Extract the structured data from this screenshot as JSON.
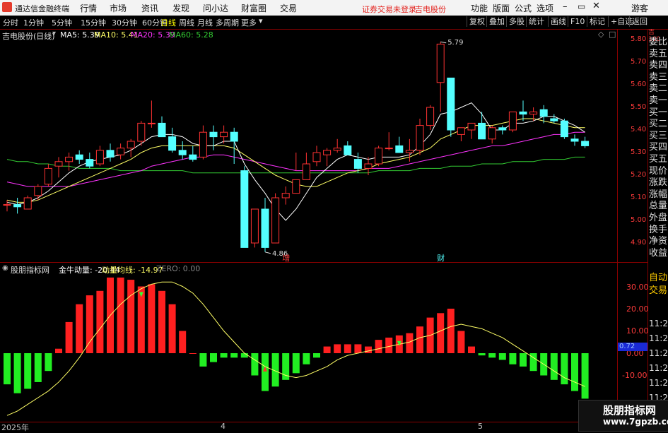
{
  "menubar": {
    "app_title": "通达信金融终端",
    "menus": [
      "行情",
      "市场",
      "资讯",
      "发现",
      "问小达",
      "财富圈",
      "交易"
    ],
    "status_text": "证券交易未登录",
    "stock_name": "吉电股份",
    "right_menus": [
      "功能",
      "版面",
      "公式",
      "选项"
    ],
    "guest": "游客"
  },
  "toolbar": {
    "timeframes": [
      "分时",
      "1分钟",
      "5分钟",
      "15分钟",
      "30分钟",
      "60分钟",
      "日线",
      "周线",
      "月线",
      "多周期",
      "更多"
    ],
    "selected": "日线",
    "buttons": [
      "复权",
      "叠加",
      "多股",
      "统计",
      "画线",
      "F10",
      "标记",
      "+自选",
      "返回"
    ]
  },
  "price_panel": {
    "title": "吉电股份(日线)",
    "ma5_label": "MA5: 5.39",
    "ma10_label": "MA10: 5.41",
    "ma20_label": "MA20: 5.39",
    "ma60_label": "MA60: 5.28",
    "high_label": "5.79",
    "low_label": "4.86",
    "marker_zeng": "增",
    "marker_cai": "财",
    "y_ticks": [
      "5.80",
      "5.70",
      "5.60",
      "5.50",
      "5.40",
      "5.30",
      "5.20",
      "5.10",
      "5.00",
      "4.90"
    ],
    "colors": {
      "up": "#ff3232",
      "down": "#54ffff",
      "ma5": "#ffffff",
      "ma10": "#ffff66",
      "ma20": "#ff33ff",
      "ma60": "#33cc33"
    }
  },
  "indicator_panel": {
    "source": "股朋指标网",
    "name_label": "金牛动量: -20.44",
    "avg_label": "动量均线: -14.97",
    "zero_label": "ZERO: 0.00",
    "y_ticks": [
      "30.00",
      "20.00",
      "10.00",
      "0.00",
      "-10.00"
    ],
    "current_tag": "0.72"
  },
  "time_axis": {
    "labels": [
      "2025年",
      "4",
      "5"
    ]
  },
  "right_panel": {
    "items": [
      "委比",
      "卖五",
      "卖四",
      "卖三",
      "卖二",
      "卖一",
      "买一",
      "买二",
      "买三",
      "买四",
      "买五",
      "现价",
      "涨跌",
      "涨幅",
      "总量",
      "外盘",
      "换手",
      "净资",
      "收益",
      "自动",
      "交易"
    ],
    "times": [
      "11:29",
      "11:29",
      "11:29",
      "11:29",
      "11:29",
      "11:29",
      "11:29"
    ]
  },
  "watermark": {
    "line1": "股朋指标网",
    "line2": "www.7gpzb.com"
  },
  "chart_data": [
    {
      "type": "candlestick",
      "title": "吉电股份(日线)",
      "ylim": [
        4.85,
        5.82
      ],
      "ohlc": [
        [
          5.07,
          5.09,
          5.04,
          5.07
        ],
        [
          5.07,
          5.1,
          5.03,
          5.06
        ],
        [
          5.05,
          5.11,
          5.05,
          5.1
        ],
        [
          5.11,
          5.16,
          5.09,
          5.15
        ],
        [
          5.16,
          5.25,
          5.15,
          5.23
        ],
        [
          5.24,
          5.28,
          5.19,
          5.26
        ],
        [
          5.26,
          5.3,
          5.22,
          5.28
        ],
        [
          5.29,
          5.31,
          5.25,
          5.27
        ],
        [
          5.27,
          5.3,
          5.23,
          5.24
        ],
        [
          5.25,
          5.33,
          5.24,
          5.31
        ],
        [
          5.31,
          5.34,
          5.26,
          5.28
        ],
        [
          5.29,
          5.34,
          5.27,
          5.32
        ],
        [
          5.32,
          5.36,
          5.28,
          5.35
        ],
        [
          5.35,
          5.44,
          5.33,
          5.43
        ],
        [
          5.43,
          5.53,
          5.41,
          5.43
        ],
        [
          5.43,
          5.46,
          5.37,
          5.37
        ],
        [
          5.37,
          5.41,
          5.3,
          5.31
        ],
        [
          5.31,
          5.35,
          5.27,
          5.29
        ],
        [
          5.29,
          5.33,
          5.26,
          5.27
        ],
        [
          5.28,
          5.42,
          5.27,
          5.39
        ],
        [
          5.39,
          5.42,
          5.31,
          5.37
        ],
        [
          5.37,
          5.42,
          5.34,
          5.39
        ],
        [
          5.39,
          5.41,
          5.25,
          5.35
        ],
        [
          5.22,
          5.24,
          4.88,
          4.88
        ],
        [
          4.9,
          5.05,
          4.88,
          5.05
        ],
        [
          5.05,
          5.1,
          4.86,
          4.88
        ],
        [
          4.9,
          5.12,
          4.9,
          5.1
        ],
        [
          5.1,
          5.15,
          5.07,
          5.12
        ],
        [
          5.12,
          5.3,
          5.22,
          5.18
        ],
        [
          5.18,
          5.3,
          5.21,
          5.25
        ],
        [
          5.26,
          5.33,
          5.24,
          5.3
        ],
        [
          5.29,
          5.32,
          5.24,
          5.31
        ],
        [
          5.31,
          5.36,
          5.3,
          5.32
        ],
        [
          5.33,
          5.35,
          5.29,
          5.29
        ],
        [
          5.27,
          5.3,
          5.21,
          5.23
        ],
        [
          5.23,
          5.28,
          5.2,
          5.25
        ],
        [
          5.25,
          5.33,
          5.24,
          5.32
        ],
        [
          5.32,
          5.39,
          5.31,
          5.32
        ],
        [
          5.33,
          5.37,
          5.3,
          5.3
        ],
        [
          5.3,
          5.36,
          5.26,
          5.31
        ],
        [
          5.31,
          5.45,
          5.29,
          5.42
        ],
        [
          5.42,
          5.51,
          5.4,
          5.5
        ],
        [
          5.61,
          5.79,
          5.48,
          5.78
        ],
        [
          5.63,
          5.63,
          5.37,
          5.4
        ],
        [
          5.38,
          5.41,
          5.35,
          5.41
        ],
        [
          5.4,
          5.43,
          5.36,
          5.43
        ],
        [
          5.43,
          5.48,
          5.39,
          5.36
        ],
        [
          5.36,
          5.42,
          5.34,
          5.41
        ],
        [
          5.41,
          5.42,
          5.38,
          5.4
        ],
        [
          5.4,
          5.48,
          5.39,
          5.48
        ],
        [
          5.48,
          5.53,
          5.44,
          5.47
        ],
        [
          5.47,
          5.5,
          5.44,
          5.48
        ],
        [
          5.49,
          5.51,
          5.43,
          5.46
        ],
        [
          5.45,
          5.47,
          5.43,
          5.44
        ],
        [
          5.44,
          5.45,
          5.36,
          5.37
        ],
        [
          5.36,
          5.38,
          5.33,
          5.35
        ],
        [
          5.35,
          5.37,
          5.32,
          5.33
        ]
      ],
      "ma5": [
        5.08,
        5.07,
        5.08,
        5.1,
        5.13,
        5.17,
        5.21,
        5.24,
        5.26,
        5.27,
        5.28,
        5.29,
        5.31,
        5.34,
        5.37,
        5.38,
        5.38,
        5.37,
        5.34,
        5.33,
        5.33,
        5.35,
        5.35,
        5.25,
        5.18,
        5.12,
        5.05,
        5.0,
        5.05,
        5.12,
        5.19,
        5.23,
        5.27,
        5.29,
        5.28,
        5.27,
        5.28,
        5.28,
        5.28,
        5.29,
        5.33,
        5.38,
        5.47,
        5.48,
        5.5,
        5.52,
        5.47,
        5.4,
        5.4,
        5.43,
        5.43,
        5.44,
        5.46,
        5.46,
        5.44,
        5.42,
        5.39
      ],
      "ma10": [
        5.09,
        5.08,
        5.08,
        5.09,
        5.11,
        5.13,
        5.15,
        5.17,
        5.19,
        5.21,
        5.23,
        5.25,
        5.27,
        5.3,
        5.32,
        5.33,
        5.33,
        5.33,
        5.33,
        5.33,
        5.33,
        5.33,
        5.32,
        5.29,
        5.26,
        5.23,
        5.2,
        5.18,
        5.16,
        5.15,
        5.15,
        5.17,
        5.19,
        5.21,
        5.22,
        5.23,
        5.25,
        5.26,
        5.27,
        5.28,
        5.3,
        5.32,
        5.36,
        5.38,
        5.4,
        5.42,
        5.42,
        5.42,
        5.43,
        5.44,
        5.45,
        5.45,
        5.44,
        5.43,
        5.42,
        5.41,
        5.41
      ],
      "ma20": [
        5.17,
        5.16,
        5.15,
        5.15,
        5.15,
        5.15,
        5.15,
        5.16,
        5.17,
        5.18,
        5.19,
        5.2,
        5.21,
        5.22,
        5.24,
        5.25,
        5.26,
        5.27,
        5.28,
        5.28,
        5.29,
        5.29,
        5.28,
        5.27,
        5.26,
        5.25,
        5.24,
        5.23,
        5.22,
        5.22,
        5.22,
        5.22,
        5.22,
        5.22,
        5.22,
        5.23,
        5.23,
        5.23,
        5.24,
        5.25,
        5.26,
        5.27,
        5.28,
        5.29,
        5.3,
        5.31,
        5.32,
        5.33,
        5.33,
        5.34,
        5.35,
        5.36,
        5.37,
        5.38,
        5.38,
        5.39,
        5.39
      ],
      "ma60": [
        5.27,
        5.26,
        5.26,
        5.25,
        5.25,
        5.24,
        5.24,
        5.23,
        5.23,
        5.23,
        5.23,
        5.22,
        5.22,
        5.22,
        5.22,
        5.22,
        5.22,
        5.22,
        5.21,
        5.21,
        5.21,
        5.21,
        5.21,
        5.21,
        5.21,
        5.21,
        5.21,
        5.21,
        5.21,
        5.21,
        5.21,
        5.21,
        5.21,
        5.21,
        5.21,
        5.21,
        5.22,
        5.22,
        5.22,
        5.22,
        5.23,
        5.23,
        5.23,
        5.24,
        5.24,
        5.24,
        5.25,
        5.25,
        5.25,
        5.26,
        5.26,
        5.26,
        5.27,
        5.27,
        5.27,
        5.28,
        5.28
      ]
    },
    {
      "type": "bar",
      "title": "金牛动量",
      "ylim": [
        -17,
        35
      ],
      "values": [
        -14,
        -18,
        -16,
        -13,
        -8,
        2,
        14,
        22,
        26,
        28,
        34,
        34,
        33,
        30,
        31,
        28,
        22,
        10,
        0,
        -6,
        -4,
        -2,
        -2,
        -2,
        -10,
        -17,
        -15,
        -12,
        -9,
        -5,
        -2,
        3,
        4,
        4,
        4,
        3,
        6,
        7,
        8,
        9,
        12,
        16,
        18,
        20,
        10,
        3,
        -1,
        -2,
        -3,
        -5,
        -6,
        -8,
        -10,
        -12,
        -14,
        -17,
        -20.44
      ],
      "avg": [
        -28,
        -26,
        -23,
        -20,
        -17,
        -13,
        -8,
        -2,
        5,
        11,
        17,
        22,
        26,
        29,
        31,
        32,
        32,
        30,
        27,
        22,
        16,
        10,
        5,
        0,
        -3,
        -6,
        -8,
        -10,
        -11,
        -10,
        -8,
        -6,
        -3,
        -1,
        0,
        1,
        2,
        3,
        4,
        5,
        7,
        8,
        10,
        12,
        13,
        12,
        11,
        9,
        7,
        4,
        1,
        -2,
        -5,
        -8,
        -11,
        -13,
        -14.97
      ],
      "arrows_down_at": [
        13,
        38
      ],
      "arrows_up_at": [
        25
      ]
    }
  ]
}
